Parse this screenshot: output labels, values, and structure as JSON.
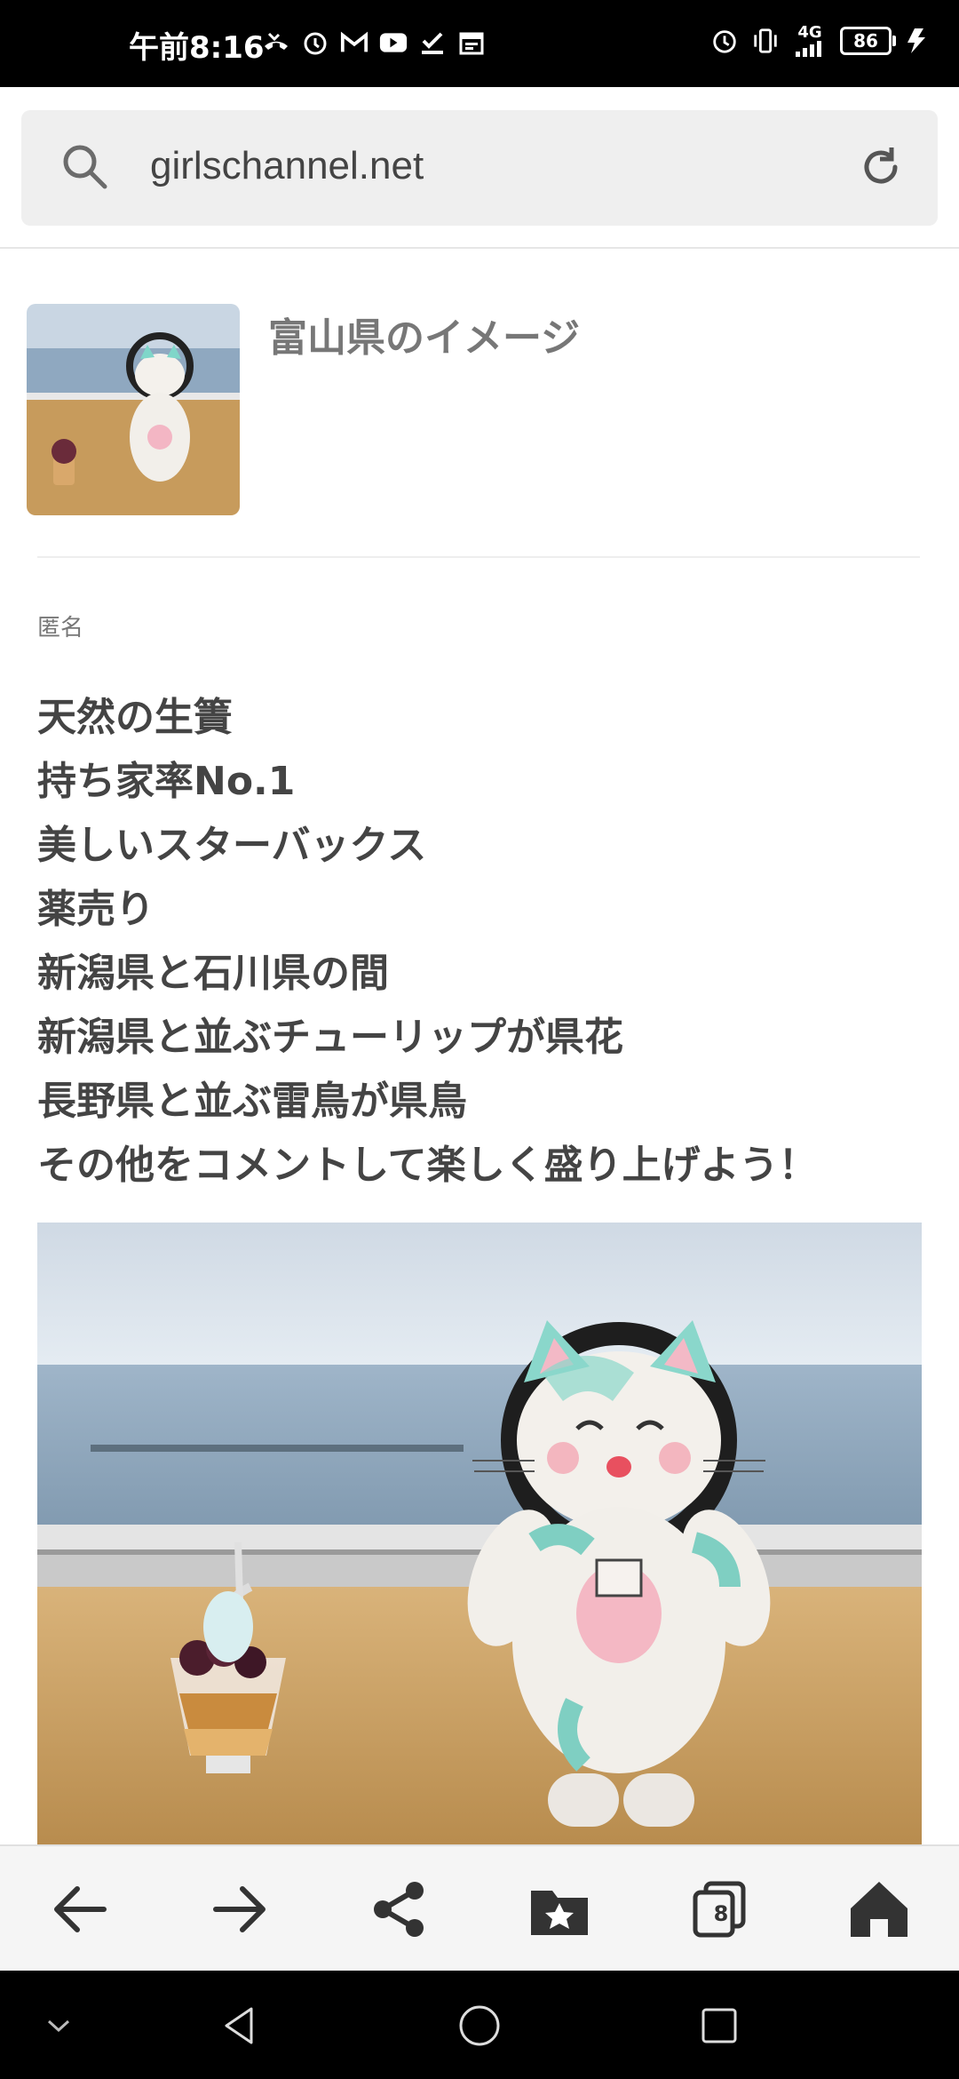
{
  "status_bar": {
    "time": "午前8:16",
    "battery": "86",
    "network": "4G"
  },
  "browser": {
    "url": "girlschannel.net",
    "tab_count": "8"
  },
  "topic": {
    "title": "富山県のイメージ"
  },
  "comment": {
    "author": "匿名",
    "lines": [
      "天然の生簀",
      "持ち家率No.1",
      "美しいスターバックス",
      "薬売り",
      "新潟県と石川県の間",
      "新潟県と並ぶチューリップが県花",
      "長野県と並ぶ雷鳥が県鳥",
      "その他をコメントして楽しく盛り上げよう！"
    ]
  }
}
